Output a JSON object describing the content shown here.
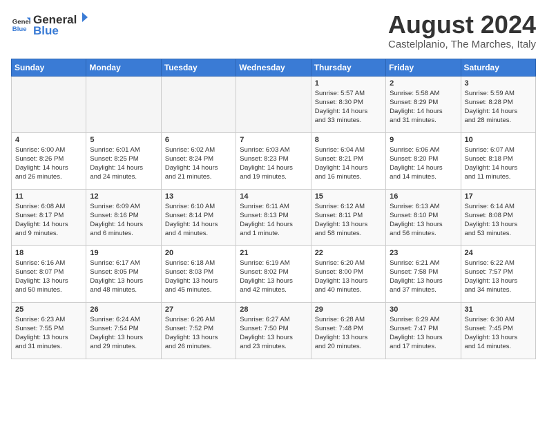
{
  "header": {
    "logo_general": "General",
    "logo_blue": "Blue",
    "month_title": "August 2024",
    "location": "Castelplanio, The Marches, Italy"
  },
  "weekdays": [
    "Sunday",
    "Monday",
    "Tuesday",
    "Wednesday",
    "Thursday",
    "Friday",
    "Saturday"
  ],
  "weeks": [
    [
      {
        "day": "",
        "content": ""
      },
      {
        "day": "",
        "content": ""
      },
      {
        "day": "",
        "content": ""
      },
      {
        "day": "",
        "content": ""
      },
      {
        "day": "1",
        "content": "Sunrise: 5:57 AM\nSunset: 8:30 PM\nDaylight: 14 hours\nand 33 minutes."
      },
      {
        "day": "2",
        "content": "Sunrise: 5:58 AM\nSunset: 8:29 PM\nDaylight: 14 hours\nand 31 minutes."
      },
      {
        "day": "3",
        "content": "Sunrise: 5:59 AM\nSunset: 8:28 PM\nDaylight: 14 hours\nand 28 minutes."
      }
    ],
    [
      {
        "day": "4",
        "content": "Sunrise: 6:00 AM\nSunset: 8:26 PM\nDaylight: 14 hours\nand 26 minutes."
      },
      {
        "day": "5",
        "content": "Sunrise: 6:01 AM\nSunset: 8:25 PM\nDaylight: 14 hours\nand 24 minutes."
      },
      {
        "day": "6",
        "content": "Sunrise: 6:02 AM\nSunset: 8:24 PM\nDaylight: 14 hours\nand 21 minutes."
      },
      {
        "day": "7",
        "content": "Sunrise: 6:03 AM\nSunset: 8:23 PM\nDaylight: 14 hours\nand 19 minutes."
      },
      {
        "day": "8",
        "content": "Sunrise: 6:04 AM\nSunset: 8:21 PM\nDaylight: 14 hours\nand 16 minutes."
      },
      {
        "day": "9",
        "content": "Sunrise: 6:06 AM\nSunset: 8:20 PM\nDaylight: 14 hours\nand 14 minutes."
      },
      {
        "day": "10",
        "content": "Sunrise: 6:07 AM\nSunset: 8:18 PM\nDaylight: 14 hours\nand 11 minutes."
      }
    ],
    [
      {
        "day": "11",
        "content": "Sunrise: 6:08 AM\nSunset: 8:17 PM\nDaylight: 14 hours\nand 9 minutes."
      },
      {
        "day": "12",
        "content": "Sunrise: 6:09 AM\nSunset: 8:16 PM\nDaylight: 14 hours\nand 6 minutes."
      },
      {
        "day": "13",
        "content": "Sunrise: 6:10 AM\nSunset: 8:14 PM\nDaylight: 14 hours\nand 4 minutes."
      },
      {
        "day": "14",
        "content": "Sunrise: 6:11 AM\nSunset: 8:13 PM\nDaylight: 14 hours\nand 1 minute."
      },
      {
        "day": "15",
        "content": "Sunrise: 6:12 AM\nSunset: 8:11 PM\nDaylight: 13 hours\nand 58 minutes."
      },
      {
        "day": "16",
        "content": "Sunrise: 6:13 AM\nSunset: 8:10 PM\nDaylight: 13 hours\nand 56 minutes."
      },
      {
        "day": "17",
        "content": "Sunrise: 6:14 AM\nSunset: 8:08 PM\nDaylight: 13 hours\nand 53 minutes."
      }
    ],
    [
      {
        "day": "18",
        "content": "Sunrise: 6:16 AM\nSunset: 8:07 PM\nDaylight: 13 hours\nand 50 minutes."
      },
      {
        "day": "19",
        "content": "Sunrise: 6:17 AM\nSunset: 8:05 PM\nDaylight: 13 hours\nand 48 minutes."
      },
      {
        "day": "20",
        "content": "Sunrise: 6:18 AM\nSunset: 8:03 PM\nDaylight: 13 hours\nand 45 minutes."
      },
      {
        "day": "21",
        "content": "Sunrise: 6:19 AM\nSunset: 8:02 PM\nDaylight: 13 hours\nand 42 minutes."
      },
      {
        "day": "22",
        "content": "Sunrise: 6:20 AM\nSunset: 8:00 PM\nDaylight: 13 hours\nand 40 minutes."
      },
      {
        "day": "23",
        "content": "Sunrise: 6:21 AM\nSunset: 7:58 PM\nDaylight: 13 hours\nand 37 minutes."
      },
      {
        "day": "24",
        "content": "Sunrise: 6:22 AM\nSunset: 7:57 PM\nDaylight: 13 hours\nand 34 minutes."
      }
    ],
    [
      {
        "day": "25",
        "content": "Sunrise: 6:23 AM\nSunset: 7:55 PM\nDaylight: 13 hours\nand 31 minutes."
      },
      {
        "day": "26",
        "content": "Sunrise: 6:24 AM\nSunset: 7:54 PM\nDaylight: 13 hours\nand 29 minutes."
      },
      {
        "day": "27",
        "content": "Sunrise: 6:26 AM\nSunset: 7:52 PM\nDaylight: 13 hours\nand 26 minutes."
      },
      {
        "day": "28",
        "content": "Sunrise: 6:27 AM\nSunset: 7:50 PM\nDaylight: 13 hours\nand 23 minutes."
      },
      {
        "day": "29",
        "content": "Sunrise: 6:28 AM\nSunset: 7:48 PM\nDaylight: 13 hours\nand 20 minutes."
      },
      {
        "day": "30",
        "content": "Sunrise: 6:29 AM\nSunset: 7:47 PM\nDaylight: 13 hours\nand 17 minutes."
      },
      {
        "day": "31",
        "content": "Sunrise: 6:30 AM\nSunset: 7:45 PM\nDaylight: 13 hours\nand 14 minutes."
      }
    ]
  ]
}
